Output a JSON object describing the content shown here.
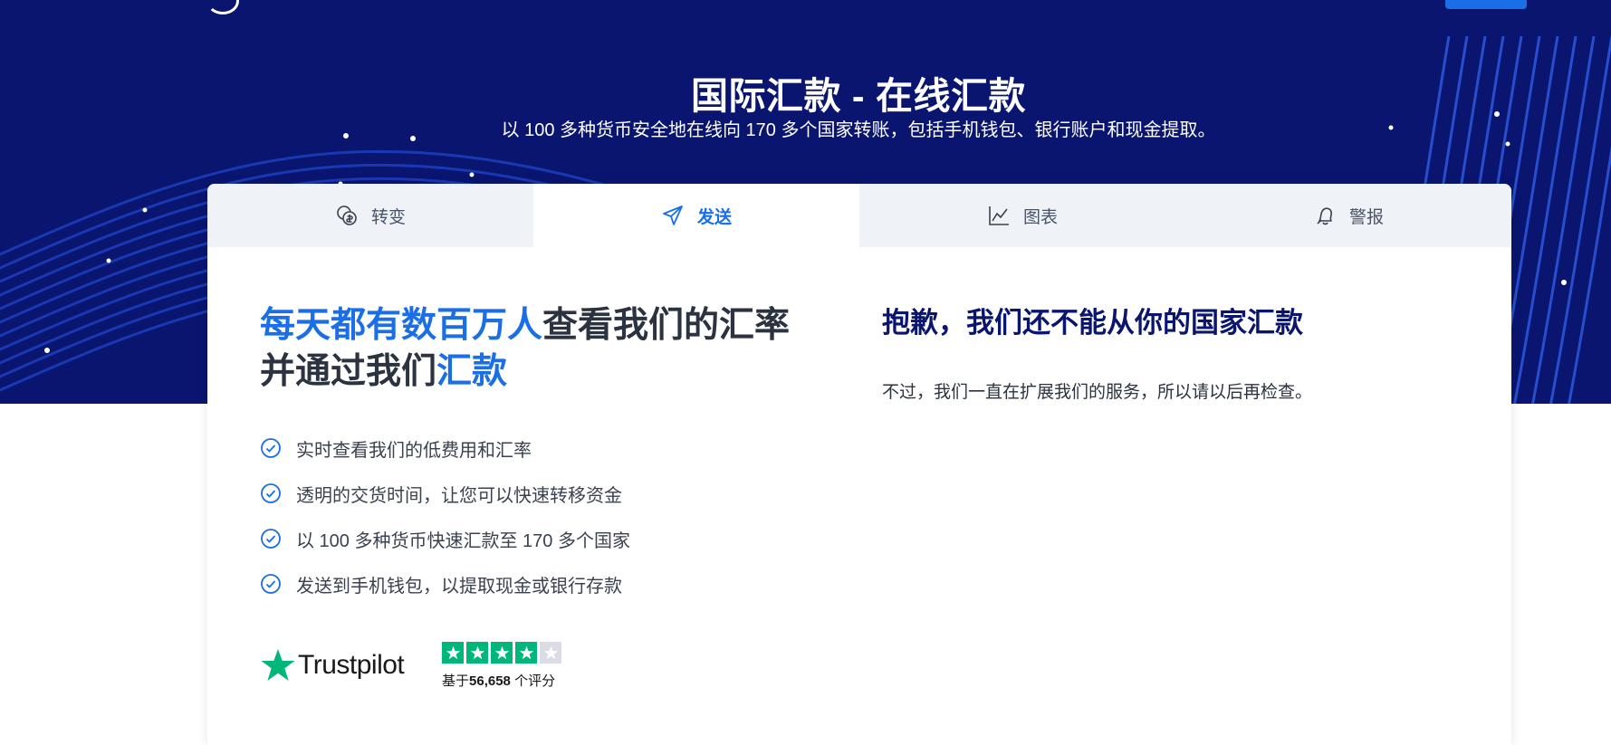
{
  "hero": {
    "title": "国际汇款 - 在线汇款",
    "subtitle": "以 100 多种货币安全地在线向 170 多个国家转账，包括手机钱包、银行账户和现金提取。"
  },
  "tabs": [
    {
      "label": "转变",
      "icon": "coins-icon",
      "active": false
    },
    {
      "label": "发送",
      "icon": "send-icon",
      "active": true
    },
    {
      "label": "图表",
      "icon": "chart-icon",
      "active": false
    },
    {
      "label": "警报",
      "icon": "bell-icon",
      "active": false
    }
  ],
  "left": {
    "headline_highlight_1": "每天都有数百万人",
    "headline_plain": "查看我们的汇率并通过我们",
    "headline_highlight_2": "汇款",
    "features": [
      "实时查看我们的低费用和汇率",
      "透明的交货时间，让您可以快速转移资金",
      "以 100 多种货币快速汇款至 170 多个国家",
      "发送到手机钱包，以提取现金或银行存款"
    ]
  },
  "trustpilot": {
    "brand": "Trustpilot",
    "rating_stars": 4,
    "max_stars": 5,
    "count_prefix": "基于",
    "count": "56,658",
    "count_suffix": " 个评分"
  },
  "right": {
    "title": "抱歉，我们还不能从你的国家汇款",
    "text": "不过，我们一直在扩展我们的服务，所以请以后再检查。"
  },
  "colors": {
    "hero_bg": "#0a1570",
    "accent": "#1a6ee6",
    "trustpilot_green": "#00b67a"
  }
}
